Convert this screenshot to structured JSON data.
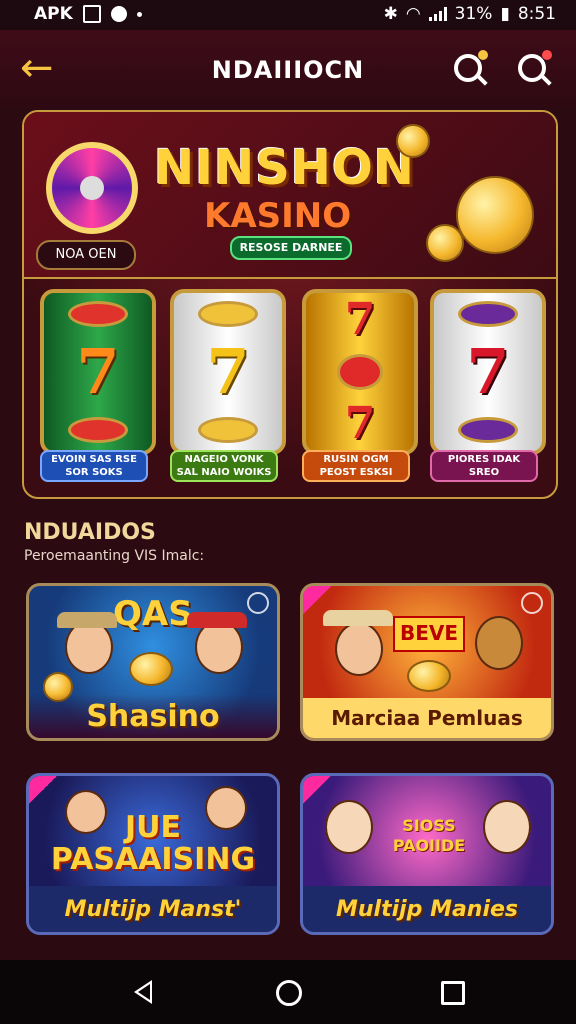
{
  "status_bar": {
    "carrier": "APK",
    "battery": "31%",
    "time": "8:51"
  },
  "app_bar": {
    "title": "NDAIIIOCN"
  },
  "hero": {
    "title": "NINSHON",
    "subtitle": "KASINO",
    "ribbon": "RESOSE DARNEE",
    "pill": "NOA OEN",
    "reel_buttons": [
      "EVOIN SAS RSE SOR SOKS",
      "NAGEIO VONK SAL NAIO WOIKS",
      "RUSIN OGM PEOST ESKSI",
      "PIORES IDAK SREO"
    ]
  },
  "section": {
    "title": "NDUAIDOS",
    "subtitle": "Peroemaanting VIS Imalc:"
  },
  "cards": [
    {
      "banner": "QAS",
      "label": "Shasino"
    },
    {
      "banner": "BEVE",
      "label": "Marciaa Pemluas"
    },
    {
      "banner": "JUE\nPASAAISING",
      "label": "Multijp Manst'"
    },
    {
      "banner": "SIOSS PAOIIDE",
      "label": "Multijp Manies"
    }
  ],
  "colors": {
    "background": "#2b0a12",
    "accent_gold": "#f5c542",
    "frame": "#c79b3b"
  }
}
